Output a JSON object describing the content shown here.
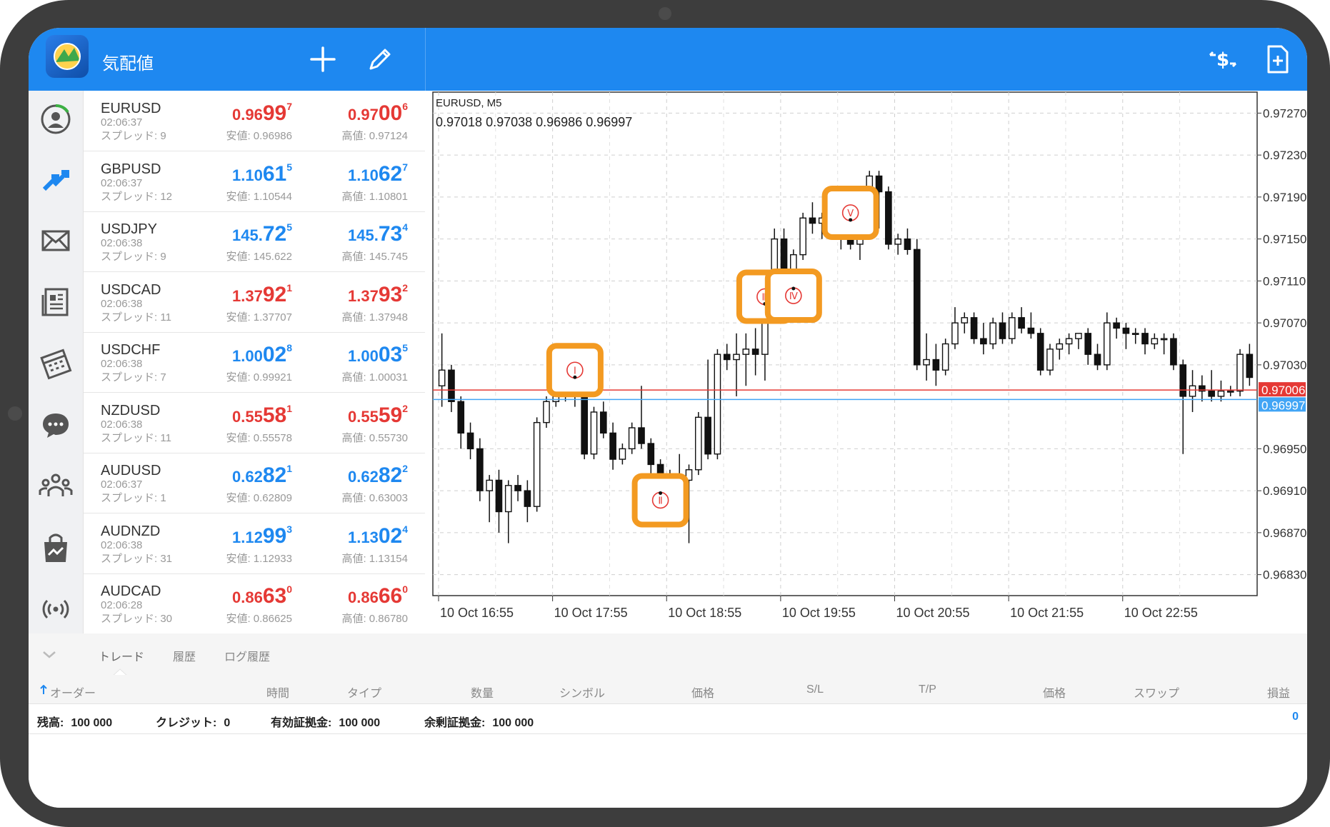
{
  "header": {
    "title": "気配値"
  },
  "quotes": [
    {
      "symbol": "EURUSD",
      "time": "02:06:37",
      "spread": "スプレッド: 9",
      "bid": {
        "a": "0.96",
        "b": "99",
        "c": "7"
      },
      "ask": {
        "a": "0.97",
        "b": "00",
        "c": "6"
      },
      "low": "安値: 0.96986",
      "high": "高値: 0.97124",
      "color": "red"
    },
    {
      "symbol": "GBPUSD",
      "time": "02:06:37",
      "spread": "スプレッド: 12",
      "bid": {
        "a": "1.10",
        "b": "61",
        "c": "5"
      },
      "ask": {
        "a": "1.10",
        "b": "62",
        "c": "7"
      },
      "low": "安値: 1.10544",
      "high": "高値: 1.10801",
      "color": "blue"
    },
    {
      "symbol": "USDJPY",
      "time": "02:06:38",
      "spread": "スプレッド: 9",
      "bid": {
        "a": "145.",
        "b": "72",
        "c": "5"
      },
      "ask": {
        "a": "145.",
        "b": "73",
        "c": "4"
      },
      "low": "安値: 145.622",
      "high": "高値: 145.745",
      "color": "blue"
    },
    {
      "symbol": "USDCAD",
      "time": "02:06:38",
      "spread": "スプレッド: 11",
      "bid": {
        "a": "1.37",
        "b": "92",
        "c": "1"
      },
      "ask": {
        "a": "1.37",
        "b": "93",
        "c": "2"
      },
      "low": "安値: 1.37707",
      "high": "高値: 1.37948",
      "color": "red"
    },
    {
      "symbol": "USDCHF",
      "time": "02:06:38",
      "spread": "スプレッド: 7",
      "bid": {
        "a": "1.00",
        "b": "02",
        "c": "8"
      },
      "ask": {
        "a": "1.00",
        "b": "03",
        "c": "5"
      },
      "low": "安値: 0.99921",
      "high": "高値: 1.00031",
      "color": "blue"
    },
    {
      "symbol": "NZDUSD",
      "time": "02:06:38",
      "spread": "スプレッド: 11",
      "bid": {
        "a": "0.55",
        "b": "58",
        "c": "1"
      },
      "ask": {
        "a": "0.55",
        "b": "59",
        "c": "2"
      },
      "low": "安値: 0.55578",
      "high": "高値: 0.55730",
      "color": "red"
    },
    {
      "symbol": "AUDUSD",
      "time": "02:06:37",
      "spread": "スプレッド: 1",
      "bid": {
        "a": "0.62",
        "b": "82",
        "c": "1"
      },
      "ask": {
        "a": "0.62",
        "b": "82",
        "c": "2"
      },
      "low": "安値: 0.62809",
      "high": "高値: 0.63003",
      "color": "blue"
    },
    {
      "symbol": "AUDNZD",
      "time": "02:06:38",
      "spread": "スプレッド: 31",
      "bid": {
        "a": "1.12",
        "b": "99",
        "c": "3"
      },
      "ask": {
        "a": "1.13",
        "b": "02",
        "c": "4"
      },
      "low": "安値: 1.12933",
      "high": "高値: 1.13154",
      "color": "blue"
    },
    {
      "symbol": "AUDCAD",
      "time": "02:06:28",
      "spread": "スプレッド: 30",
      "bid": {
        "a": "0.86",
        "b": "63",
        "c": "0"
      },
      "ask": {
        "a": "0.86",
        "b": "66",
        "c": "0"
      },
      "low": "安値: 0.86625",
      "high": "高値: 0.86780",
      "color": "red"
    }
  ],
  "chart": {
    "symbol_label": "EURUSD, M5",
    "ohlc_label": "0.97018 0.97038 0.96986 0.96997",
    "y_ticks": [
      "0.97270",
      "0.97230",
      "0.97190",
      "0.97150",
      "0.97110",
      "0.97070",
      "0.97030",
      "0.96950",
      "0.96910",
      "0.96870",
      "0.96830"
    ],
    "y_tick_values": [
      0.9727,
      0.9723,
      0.9719,
      0.9715,
      0.9711,
      0.9707,
      0.9703,
      0.9695,
      0.9691,
      0.9687,
      0.9683
    ],
    "x_ticks": [
      "10 Oct 16:55",
      "10 Oct 17:55",
      "10 Oct 18:55",
      "10 Oct 19:55",
      "10 Oct 20:55",
      "10 Oct 21:55",
      "10 Oct 22:55"
    ],
    "ask_line": {
      "value": 0.97006,
      "label": "0.97006",
      "color": "#e53935"
    },
    "bid_line": {
      "value": 0.96997,
      "label": "0.96997",
      "color": "#42a5f5"
    },
    "wave_labels": [
      {
        "label": "Ⓘ",
        "name": "wave-1",
        "bar": 14
      },
      {
        "label": "Ⓘⓘ",
        "name": "wave-2",
        "bar": 23
      },
      {
        "label": "Ⓘⓘⓘ",
        "name": "wave-3",
        "bar": 34
      },
      {
        "label": "Ⓘⓥ",
        "name": "wave-4",
        "bar": 37
      },
      {
        "label": "Ⓥ",
        "name": "wave-5",
        "bar": 43
      }
    ],
    "wave_marks": [
      "Ⅰ",
      "Ⅱ",
      "Ⅲ",
      "Ⅳ",
      "Ⅴ"
    ],
    "highlight_color": "#f39a21"
  },
  "chart_data": {
    "type": "candlestick",
    "title": "EURUSD, M5",
    "ylim": [
      0.9681,
      0.9729
    ],
    "x_tick_labels": [
      "10 Oct 16:55",
      "10 Oct 17:55",
      "10 Oct 18:55",
      "10 Oct 19:55",
      "10 Oct 20:55",
      "10 Oct 21:55",
      "10 Oct 22:55"
    ],
    "candles": [
      {
        "o": 0.9701,
        "h": 0.9706,
        "l": 0.9699,
        "c": 0.97025
      },
      {
        "o": 0.97025,
        "h": 0.9703,
        "l": 0.96985,
        "c": 0.96995
      },
      {
        "o": 0.96995,
        "h": 0.97,
        "l": 0.9695,
        "c": 0.96965
      },
      {
        "o": 0.96965,
        "h": 0.96975,
        "l": 0.9694,
        "c": 0.9695
      },
      {
        "o": 0.9695,
        "h": 0.9696,
        "l": 0.969,
        "c": 0.9691
      },
      {
        "o": 0.9691,
        "h": 0.96925,
        "l": 0.9688,
        "c": 0.9692
      },
      {
        "o": 0.9692,
        "h": 0.9693,
        "l": 0.9687,
        "c": 0.9689
      },
      {
        "o": 0.9689,
        "h": 0.9692,
        "l": 0.9686,
        "c": 0.96915
      },
      {
        "o": 0.96915,
        "h": 0.96925,
        "l": 0.969,
        "c": 0.9691
      },
      {
        "o": 0.9691,
        "h": 0.9692,
        "l": 0.9688,
        "c": 0.96895
      },
      {
        "o": 0.96895,
        "h": 0.9698,
        "l": 0.9689,
        "c": 0.96975
      },
      {
        "o": 0.96975,
        "h": 0.97,
        "l": 0.9697,
        "c": 0.96995
      },
      {
        "o": 0.96995,
        "h": 0.97005,
        "l": 0.9699,
        "c": 0.97
      },
      {
        "o": 0.97,
        "h": 0.9701,
        "l": 0.96995,
        "c": 0.97005
      },
      {
        "o": 0.97005,
        "h": 0.9701,
        "l": 0.9699,
        "c": 0.97
      },
      {
        "o": 0.97,
        "h": 0.97005,
        "l": 0.9694,
        "c": 0.96945
      },
      {
        "o": 0.96945,
        "h": 0.9699,
        "l": 0.9694,
        "c": 0.96985
      },
      {
        "o": 0.96985,
        "h": 0.96995,
        "l": 0.9696,
        "c": 0.96965
      },
      {
        "o": 0.96965,
        "h": 0.96975,
        "l": 0.9693,
        "c": 0.9694
      },
      {
        "o": 0.9694,
        "h": 0.96955,
        "l": 0.96935,
        "c": 0.9695
      },
      {
        "o": 0.9695,
        "h": 0.96975,
        "l": 0.96945,
        "c": 0.9697
      },
      {
        "o": 0.9697,
        "h": 0.9701,
        "l": 0.9695,
        "c": 0.96955
      },
      {
        "o": 0.96955,
        "h": 0.9696,
        "l": 0.96925,
        "c": 0.96935
      },
      {
        "o": 0.96935,
        "h": 0.9694,
        "l": 0.9692,
        "c": 0.96925
      },
      {
        "o": 0.96925,
        "h": 0.9693,
        "l": 0.96915,
        "c": 0.96925
      },
      {
        "o": 0.96925,
        "h": 0.96945,
        "l": 0.96915,
        "c": 0.9692
      },
      {
        "o": 0.9692,
        "h": 0.96935,
        "l": 0.9686,
        "c": 0.9693
      },
      {
        "o": 0.9693,
        "h": 0.96985,
        "l": 0.96925,
        "c": 0.9698
      },
      {
        "o": 0.9698,
        "h": 0.97035,
        "l": 0.9694,
        "c": 0.96945
      },
      {
        "o": 0.96945,
        "h": 0.97045,
        "l": 0.9694,
        "c": 0.9704
      },
      {
        "o": 0.9704,
        "h": 0.9705,
        "l": 0.97025,
        "c": 0.97035
      },
      {
        "o": 0.97035,
        "h": 0.9706,
        "l": 0.97,
        "c": 0.9704
      },
      {
        "o": 0.9704,
        "h": 0.9706,
        "l": 0.9701,
        "c": 0.97045
      },
      {
        "o": 0.97045,
        "h": 0.97065,
        "l": 0.9702,
        "c": 0.9704
      },
      {
        "o": 0.9704,
        "h": 0.9708,
        "l": 0.97015,
        "c": 0.97075
      },
      {
        "o": 0.97075,
        "h": 0.9716,
        "l": 0.9707,
        "c": 0.9715
      },
      {
        "o": 0.9715,
        "h": 0.9716,
        "l": 0.9711,
        "c": 0.9712
      },
      {
        "o": 0.9712,
        "h": 0.9714,
        "l": 0.97115,
        "c": 0.97135
      },
      {
        "o": 0.97135,
        "h": 0.97175,
        "l": 0.9713,
        "c": 0.9717
      },
      {
        "o": 0.9717,
        "h": 0.97185,
        "l": 0.97155,
        "c": 0.97165
      },
      {
        "o": 0.97165,
        "h": 0.97175,
        "l": 0.9715,
        "c": 0.9717
      },
      {
        "o": 0.9717,
        "h": 0.97185,
        "l": 0.9716,
        "c": 0.9716
      },
      {
        "o": 0.9716,
        "h": 0.97175,
        "l": 0.9714,
        "c": 0.9715
      },
      {
        "o": 0.9715,
        "h": 0.9716,
        "l": 0.9714,
        "c": 0.97145
      },
      {
        "o": 0.97145,
        "h": 0.9716,
        "l": 0.9713,
        "c": 0.97155
      },
      {
        "o": 0.97155,
        "h": 0.97215,
        "l": 0.9715,
        "c": 0.9721
      },
      {
        "o": 0.9721,
        "h": 0.97215,
        "l": 0.9716,
        "c": 0.97195
      },
      {
        "o": 0.97195,
        "h": 0.972,
        "l": 0.9714,
        "c": 0.97145
      },
      {
        "o": 0.97145,
        "h": 0.97155,
        "l": 0.97135,
        "c": 0.9715
      },
      {
        "o": 0.9715,
        "h": 0.9716,
        "l": 0.97135,
        "c": 0.9714
      },
      {
        "o": 0.9714,
        "h": 0.9715,
        "l": 0.97025,
        "c": 0.9703
      },
      {
        "o": 0.9703,
        "h": 0.9706,
        "l": 0.97015,
        "c": 0.97035
      },
      {
        "o": 0.97035,
        "h": 0.9705,
        "l": 0.9701,
        "c": 0.97025
      },
      {
        "o": 0.97025,
        "h": 0.97055,
        "l": 0.9702,
        "c": 0.9705
      },
      {
        "o": 0.9705,
        "h": 0.97085,
        "l": 0.97045,
        "c": 0.9707
      },
      {
        "o": 0.9707,
        "h": 0.9708,
        "l": 0.9706,
        "c": 0.97075
      },
      {
        "o": 0.97075,
        "h": 0.9708,
        "l": 0.9705,
        "c": 0.97055
      },
      {
        "o": 0.97055,
        "h": 0.9707,
        "l": 0.9704,
        "c": 0.9705
      },
      {
        "o": 0.9705,
        "h": 0.97075,
        "l": 0.97045,
        "c": 0.9707
      },
      {
        "o": 0.9707,
        "h": 0.9708,
        "l": 0.9705,
        "c": 0.97055
      },
      {
        "o": 0.97055,
        "h": 0.9708,
        "l": 0.9705,
        "c": 0.97075
      },
      {
        "o": 0.97075,
        "h": 0.97085,
        "l": 0.9706,
        "c": 0.97065
      },
      {
        "o": 0.97065,
        "h": 0.9708,
        "l": 0.97055,
        "c": 0.9706
      },
      {
        "o": 0.9706,
        "h": 0.97065,
        "l": 0.9702,
        "c": 0.97025
      },
      {
        "o": 0.97025,
        "h": 0.9705,
        "l": 0.9702,
        "c": 0.97045
      },
      {
        "o": 0.97045,
        "h": 0.97055,
        "l": 0.97035,
        "c": 0.9705
      },
      {
        "o": 0.9705,
        "h": 0.9706,
        "l": 0.9704,
        "c": 0.97055
      },
      {
        "o": 0.97055,
        "h": 0.9706,
        "l": 0.97045,
        "c": 0.9706
      },
      {
        "o": 0.9706,
        "h": 0.97065,
        "l": 0.9703,
        "c": 0.9704
      },
      {
        "o": 0.9704,
        "h": 0.9705,
        "l": 0.97025,
        "c": 0.9703
      },
      {
        "o": 0.9703,
        "h": 0.9708,
        "l": 0.97025,
        "c": 0.9707
      },
      {
        "o": 0.9707,
        "h": 0.97075,
        "l": 0.97055,
        "c": 0.97065
      },
      {
        "o": 0.97065,
        "h": 0.9707,
        "l": 0.97045,
        "c": 0.9706
      },
      {
        "o": 0.9706,
        "h": 0.97065,
        "l": 0.9705,
        "c": 0.9706
      },
      {
        "o": 0.9706,
        "h": 0.97065,
        "l": 0.9704,
        "c": 0.9705
      },
      {
        "o": 0.9705,
        "h": 0.9706,
        "l": 0.97045,
        "c": 0.97055
      },
      {
        "o": 0.97055,
        "h": 0.9706,
        "l": 0.9704,
        "c": 0.97055
      },
      {
        "o": 0.97055,
        "h": 0.9706,
        "l": 0.97025,
        "c": 0.9703
      },
      {
        "o": 0.9703,
        "h": 0.97035,
        "l": 0.96945,
        "c": 0.97
      },
      {
        "o": 0.97,
        "h": 0.97025,
        "l": 0.96985,
        "c": 0.9701
      },
      {
        "o": 0.9701,
        "h": 0.9702,
        "l": 0.96995,
        "c": 0.97005
      },
      {
        "o": 0.97005,
        "h": 0.97025,
        "l": 0.96995,
        "c": 0.97
      },
      {
        "o": 0.97,
        "h": 0.97015,
        "l": 0.96995,
        "c": 0.97005
      },
      {
        "o": 0.97005,
        "h": 0.9701,
        "l": 0.97,
        "c": 0.97005
      },
      {
        "o": 0.97005,
        "h": 0.97045,
        "l": 0.97,
        "c": 0.9704
      },
      {
        "o": 0.9704,
        "h": 0.9705,
        "l": 0.9701,
        "c": 0.97018
      }
    ]
  },
  "bottom": {
    "tabs": [
      "トレード",
      "履歴",
      "ログ履歴"
    ],
    "columns": [
      "オーダー",
      "時間",
      "タイプ",
      "数量",
      "シンボル",
      "価格",
      "S/L",
      "T/P",
      "価格",
      "スワップ",
      "損益"
    ],
    "summary": [
      {
        "label": "残高:",
        "value": "100 000"
      },
      {
        "label": "クレジット:",
        "value": "0"
      },
      {
        "label": "有効証拠金:",
        "value": "100 000"
      },
      {
        "label": "余剰証拠金:",
        "value": "100 000"
      }
    ],
    "profit": "0"
  }
}
